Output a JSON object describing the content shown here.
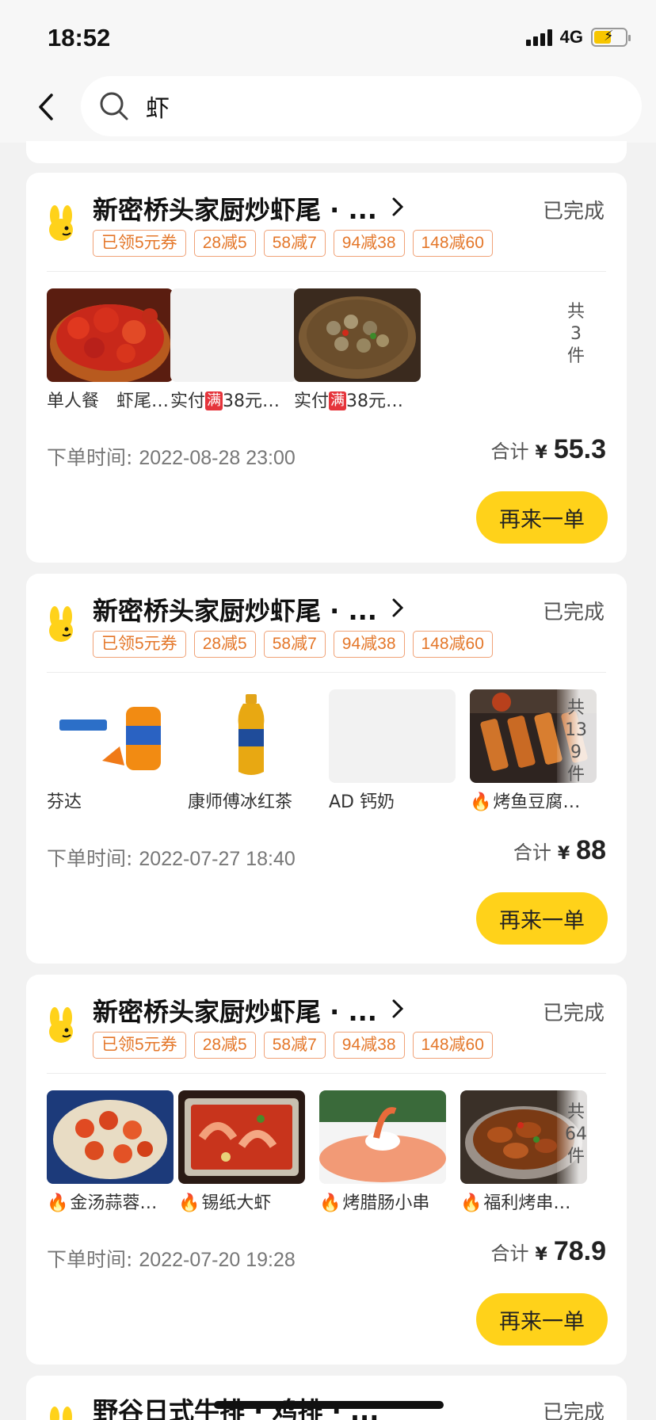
{
  "status_bar": {
    "time": "18:52",
    "network": "4G"
  },
  "search": {
    "query": "虾"
  },
  "orders": [
    {
      "shop_name": "新密桥头家厨炒虾尾 · ...",
      "status": "已完成",
      "coupons": [
        "已领5元券",
        "28减5",
        "58减7",
        "94减38",
        "148减60"
      ],
      "items": [
        {
          "name": "单人餐　虾尾…",
          "fire": "",
          "badge": "",
          "name_suffix": ""
        },
        {
          "name": "实付",
          "fire": "",
          "badge": "满",
          "name_suffix": "38元…"
        },
        {
          "name": "实付",
          "fire": "",
          "badge": "满",
          "name_suffix": "38元…"
        }
      ],
      "count_text": [
        "共",
        "3",
        "件"
      ],
      "time_label": "下单时间:",
      "time_value": "2022-08-28 23:00",
      "total_label": "合计",
      "currency": "¥",
      "total": "55.3",
      "reorder_label": "再来一单"
    },
    {
      "shop_name": "新密桥头家厨炒虾尾 · ...",
      "status": "已完成",
      "coupons": [
        "已领5元券",
        "28减5",
        "58减7",
        "94减38",
        "148减60"
      ],
      "items": [
        {
          "name": "芬达",
          "fire": ""
        },
        {
          "name": "康师傅冰红茶",
          "fire": ""
        },
        {
          "name": "AD 钙奶",
          "fire": ""
        },
        {
          "name": "烤鱼豆腐…",
          "fire": "🔥"
        }
      ],
      "count_text": [
        "共",
        "13",
        "9",
        "件"
      ],
      "time_label": "下单时间:",
      "time_value": "2022-07-27 18:40",
      "total_label": "合计",
      "currency": "¥",
      "total": "88",
      "reorder_label": "再来一单"
    },
    {
      "shop_name": "新密桥头家厨炒虾尾 · ...",
      "status": "已完成",
      "coupons": [
        "已领5元券",
        "28减5",
        "58减7",
        "94减38",
        "148减60"
      ],
      "items": [
        {
          "name": "金汤蒜蓉…",
          "fire": "🔥"
        },
        {
          "name": "锡纸大虾",
          "fire": "🔥"
        },
        {
          "name": "烤腊肠小串",
          "fire": "🔥"
        },
        {
          "name": "福利烤串…",
          "fire": "🔥"
        }
      ],
      "count_text": [
        "共",
        "64",
        "件"
      ],
      "time_label": "下单时间:",
      "time_value": "2022-07-20 19:28",
      "total_label": "合计",
      "currency": "¥",
      "total": "78.9",
      "reorder_label": "再来一单"
    }
  ],
  "next_order": {
    "shop_name": "野谷日式牛排 · 鸡排 · ...",
    "status": "已完成"
  },
  "colors": {
    "accent": "#ffd21a",
    "coupon": "#e4772a",
    "badge_red": "#e5343b"
  }
}
